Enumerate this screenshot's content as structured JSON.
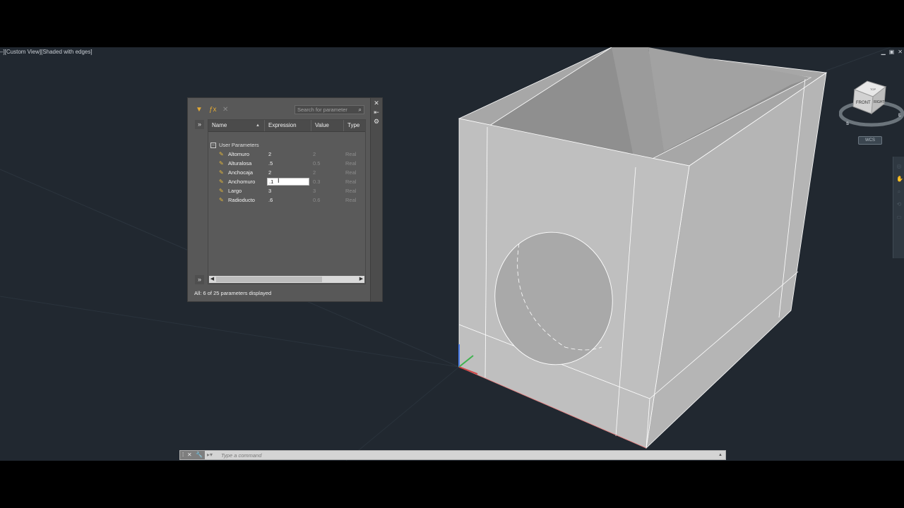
{
  "viewport": {
    "label": "–][Custom View][Shaded with edges]",
    "controls": [
      "▁",
      "▣",
      "✕"
    ],
    "viewcube": {
      "top": "TOP",
      "front": "FRONT",
      "right": "RIGHT",
      "compass_s": "S",
      "compass_e": "E"
    },
    "wcs_label": "WCS"
  },
  "parameters_manager": {
    "search_placeholder": "Search for parameter",
    "columns": [
      "Name",
      "Expression",
      "Value",
      "Type"
    ],
    "group_label": "User Parameters",
    "parameters": [
      {
        "name": "Altomuro",
        "expression": "2",
        "value": "2",
        "type": "Real"
      },
      {
        "name": "Alturalosa",
        "expression": ".5",
        "value": "0.5",
        "type": "Real"
      },
      {
        "name": "Anchocaja",
        "expression": "2",
        "value": "2",
        "type": "Real"
      },
      {
        "name": "Anchomuro",
        "expression": ".1",
        "value": "0.3",
        "type": "Real",
        "editing": true
      },
      {
        "name": "Largo",
        "expression": "3",
        "value": "3",
        "type": "Real"
      },
      {
        "name": "Radioducto",
        "expression": ".6",
        "value": "0.6",
        "type": "Real"
      }
    ],
    "status": "All: 6 of 25 parameters displayed"
  },
  "command_line": {
    "placeholder": "Type a command"
  },
  "colors": {
    "viewport_bg": "#212830",
    "palette_bg": "#585858",
    "model_face": "#bdbdbd",
    "param_icon": "#e5b93b"
  }
}
